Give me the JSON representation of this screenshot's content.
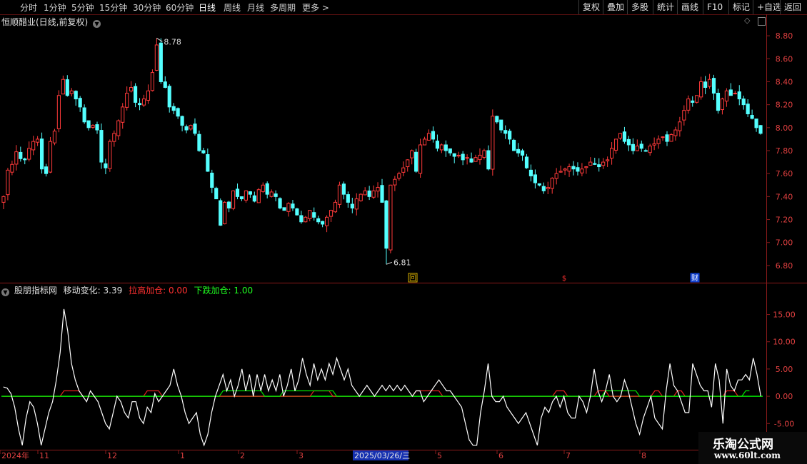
{
  "toolbar": {
    "periods": [
      "分时",
      "1分钟",
      "5分钟",
      "15分钟",
      "30分钟",
      "60分钟",
      "日线",
      "周线",
      "月线",
      "多周期",
      "更多 >"
    ],
    "active_period": "日线",
    "right_buttons": [
      "复权",
      "叠加",
      "多股",
      "统计",
      "画线",
      "F10",
      "标记",
      "+自选",
      "返回"
    ]
  },
  "stock_header": {
    "title": "恒顺醋业(日线,前复权)"
  },
  "indicator_header": {
    "name": "股朋指标网",
    "line_label": "移动变化:",
    "line_value": "3.39",
    "red_label": "拉高加仓:",
    "red_value": "0.00",
    "green_label": "下跌加仓:",
    "green_value": "1.00"
  },
  "price_markers": {
    "high_label": "8.78",
    "low_label": "6.81",
    "event_icons": [
      "回",
      "$",
      "财"
    ]
  },
  "x_axis": {
    "labels": [
      "2024年",
      "11",
      "12",
      "1",
      "2",
      "3",
      "2025/03/26/三",
      "5",
      "6",
      "7",
      "8"
    ]
  },
  "watermark": {
    "line1": "乐淘公式网",
    "line2": "www.60lt.com"
  },
  "colors": {
    "up": "#ff3a3a",
    "down": "#54ffff",
    "line": "#ffffff",
    "green": "#00e000",
    "red": "#e02020",
    "axis": "#8a1a1a"
  },
  "chart_data": [
    {
      "type": "candlestick",
      "title": "恒顺醋业(日线,前复权)",
      "ylim": [
        6.7,
        8.9
      ],
      "yticks": [
        6.8,
        7.0,
        7.2,
        7.4,
        7.6,
        7.8,
        8.0,
        8.2,
        8.4,
        8.6,
        8.8
      ],
      "x_labels": [
        "2024年",
        "11",
        "12",
        "1",
        "2",
        "3",
        "2025/03/26/三",
        "5",
        "6",
        "7",
        "8"
      ],
      "high_marker": 8.78,
      "low_marker": 6.81,
      "closes": [
        7.4,
        7.63,
        7.68,
        7.79,
        7.73,
        7.72,
        7.82,
        7.88,
        7.9,
        7.64,
        7.6,
        7.88,
        7.97,
        8.28,
        8.42,
        8.28,
        8.32,
        8.25,
        8.18,
        8.05,
        8.0,
        8.02,
        7.98,
        7.7,
        7.65,
        7.88,
        7.95,
        8.06,
        8.18,
        8.3,
        8.35,
        8.22,
        8.2,
        8.25,
        8.32,
        8.48,
        8.72,
        8.4,
        8.35,
        8.18,
        8.15,
        8.1,
        8.02,
        7.98,
        8.02,
        7.95,
        7.8,
        7.78,
        7.62,
        7.48,
        7.38,
        7.15,
        7.35,
        7.3,
        7.45,
        7.4,
        7.38,
        7.45,
        7.42,
        7.36,
        7.46,
        7.5,
        7.42,
        7.44,
        7.4,
        7.3,
        7.28,
        7.34,
        7.3,
        7.24,
        7.18,
        7.22,
        7.28,
        7.22,
        7.18,
        7.16,
        7.22,
        7.28,
        7.35,
        7.5,
        7.42,
        7.35,
        7.3,
        7.38,
        7.42,
        7.45,
        7.4,
        7.45,
        7.48,
        7.35,
        6.95,
        7.5,
        7.55,
        7.6,
        7.65,
        7.72,
        7.8,
        7.62,
        7.85,
        7.9,
        7.95,
        7.9,
        7.82,
        7.85,
        7.8,
        7.78,
        7.75,
        7.76,
        7.72,
        7.74,
        7.7,
        7.74,
        7.76,
        7.8,
        7.64,
        8.1,
        8.05,
        7.98,
        7.95,
        7.9,
        7.8,
        7.78,
        7.76,
        7.65,
        7.58,
        7.52,
        7.5,
        7.45,
        7.48,
        7.56,
        7.6,
        7.62,
        7.64,
        7.66,
        7.64,
        7.62,
        7.64,
        7.66,
        7.7,
        7.68,
        7.66,
        7.7,
        7.72,
        7.82,
        7.9,
        7.95,
        7.88,
        7.85,
        7.8,
        7.84,
        7.82,
        7.8,
        7.84,
        7.86,
        7.9,
        7.92,
        7.88,
        7.94,
        7.98,
        8.05,
        8.15,
        8.25,
        8.22,
        8.28,
        8.4,
        8.35,
        8.42,
        8.3,
        8.15,
        8.25,
        8.32,
        8.28,
        8.3,
        8.25,
        8.2,
        8.12,
        8.08,
        8.0,
        7.95
      ]
    },
    {
      "type": "line",
      "title": "股朋指标网",
      "ylim": [
        -8.5,
        19
      ],
      "yticks": [
        -5.0,
        0.0,
        5.0,
        10.0,
        15.0
      ],
      "series": [
        {
          "name": "移动变化",
          "values": [
            1.7,
            1.5,
            0.5,
            -2,
            -6,
            -9,
            -4,
            -1,
            -2,
            -5,
            -9,
            -6,
            -3,
            -1,
            3,
            8,
            16,
            12,
            6,
            3,
            1,
            0,
            -1,
            1,
            0,
            -1,
            -3,
            -5,
            -6,
            -3,
            0,
            -1,
            -3,
            -4,
            -1,
            -1,
            -4,
            -5,
            -2,
            -3,
            0.5,
            -1,
            0,
            1,
            2,
            5,
            2,
            0,
            -3,
            -5,
            -4,
            -3,
            -7,
            -9,
            -7,
            -3,
            0,
            2,
            4,
            1,
            3,
            0,
            2,
            5,
            1,
            4,
            0,
            4,
            1,
            4,
            1,
            3,
            1,
            4,
            0,
            2,
            5,
            1,
            3,
            7,
            4,
            2,
            6,
            3,
            5,
            3,
            6,
            4,
            7,
            5,
            3,
            5,
            2,
            1,
            0,
            1,
            2,
            1,
            0,
            1,
            2,
            1,
            2,
            1,
            2,
            1,
            2,
            1,
            0,
            1,
            1,
            -1,
            0,
            1,
            2,
            3,
            2,
            1,
            1,
            0,
            -1,
            -2,
            -5,
            -8,
            -9,
            -9,
            -3,
            1,
            6,
            0,
            -1,
            -1,
            0,
            -2,
            -3,
            -4,
            -5,
            -4,
            -3,
            -5,
            -7,
            -9,
            -4,
            -2,
            -3,
            -1,
            0,
            -2,
            0,
            -3,
            -4,
            -4,
            0,
            -1,
            -3,
            0,
            5,
            1,
            -1,
            1,
            4,
            0,
            -1,
            0,
            3,
            1,
            -2,
            -5,
            -7,
            -4,
            -2,
            0,
            -4,
            -5,
            -6,
            1,
            6,
            2,
            1,
            -1,
            -3,
            -3,
            6,
            4,
            2,
            1,
            1,
            -2,
            6,
            3,
            -5,
            5,
            2,
            1,
            3,
            3,
            4,
            3,
            7,
            4,
            0
          ]
        },
        {
          "name": "拉高加仓",
          "values": [
            0,
            0,
            0,
            0,
            0,
            0,
            0,
            0,
            0,
            0,
            0,
            0,
            0,
            0,
            0,
            0,
            1,
            1,
            1,
            1,
            1,
            0,
            0,
            0,
            0,
            0,
            0,
            0,
            0,
            0,
            0,
            0,
            0,
            0,
            0,
            0,
            0,
            0,
            1,
            1,
            1,
            1,
            0,
            0,
            0,
            0,
            0,
            0,
            0,
            0,
            0,
            0,
            0,
            0,
            0,
            0,
            0,
            0,
            0,
            0,
            0,
            0,
            0,
            0,
            0,
            0,
            0,
            0,
            0,
            0,
            0,
            0,
            0,
            0,
            0,
            0,
            0,
            0,
            0,
            0,
            0,
            0,
            1,
            1,
            1,
            1,
            1,
            0,
            0,
            0,
            0,
            0,
            0,
            0,
            0,
            0,
            0,
            0,
            0,
            0,
            0,
            0,
            0,
            0,
            0,
            0,
            0,
            0,
            0,
            1,
            1,
            1,
            1,
            1,
            1,
            1,
            0,
            0,
            0,
            0,
            0,
            0,
            0,
            0,
            0,
            0,
            0,
            0,
            0,
            0,
            0,
            0,
            0,
            0,
            0,
            0,
            0,
            0,
            0,
            0,
            0,
            0,
            0,
            0,
            0,
            0,
            1,
            1,
            1,
            0,
            0,
            0,
            0,
            0,
            0,
            0,
            0,
            1,
            1,
            1,
            0,
            0,
            0,
            0,
            0,
            0,
            0,
            0,
            0,
            0,
            0,
            0,
            1,
            1,
            0,
            0,
            0,
            0,
            1,
            1,
            0,
            0,
            0,
            0,
            0,
            0,
            0,
            0,
            0,
            0,
            0,
            1,
            1,
            1,
            0,
            0
          ]
        },
        {
          "name": "下跌加仓",
          "values": [
            0,
            0,
            0,
            0,
            0,
            0,
            0,
            0,
            0,
            0,
            0,
            0,
            0,
            0,
            0,
            0,
            0,
            0,
            0,
            0,
            0,
            0,
            0,
            0,
            0,
            0,
            0,
            0,
            0,
            0,
            0,
            0,
            0,
            0,
            0,
            0,
            0,
            0,
            0,
            0,
            0,
            0,
            0,
            0,
            0,
            0,
            0,
            0,
            0,
            0,
            0,
            0,
            0,
            0,
            0,
            0,
            0,
            0,
            1,
            1,
            1,
            1,
            1,
            1,
            1,
            1,
            1,
            1,
            1,
            0,
            0,
            0,
            0,
            0,
            1,
            1,
            1,
            1,
            1,
            1,
            1,
            1,
            1,
            1,
            1,
            1,
            1,
            1,
            0,
            0,
            0,
            0,
            0,
            0,
            0,
            0,
            0,
            0,
            0,
            0,
            0,
            0,
            0,
            0,
            0,
            0,
            0,
            0,
            0,
            0,
            0,
            0,
            0,
            0,
            0,
            0,
            0,
            0,
            0,
            0,
            0,
            0,
            0,
            0,
            0,
            0,
            0,
            0,
            0,
            0,
            0,
            0,
            0,
            0,
            0,
            0,
            0,
            0,
            0,
            0,
            0,
            0,
            0,
            0,
            0,
            0,
            0,
            0,
            0,
            0,
            0,
            0,
            0,
            0,
            0,
            0,
            0,
            0,
            0,
            1,
            1,
            1,
            1,
            1,
            1,
            1,
            1,
            1,
            0,
            0,
            0,
            0,
            0,
            0,
            0,
            0,
            0,
            0,
            0,
            0,
            0,
            0,
            0,
            0,
            0,
            0,
            0,
            0,
            0,
            0,
            0,
            0,
            0,
            0,
            0,
            0,
            1,
            1
          ]
        }
      ]
    }
  ]
}
